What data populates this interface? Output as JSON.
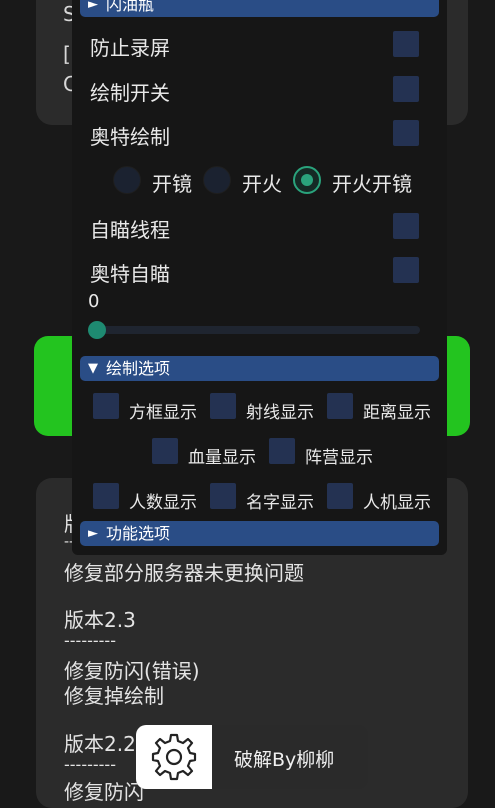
{
  "background": {
    "stubs": [
      "S",
      "[",
      "C"
    ],
    "log_lines_top": [
      "版",
      "--",
      "修复部分服务器未更换问题"
    ],
    "changelog": [
      {
        "version": "版本2.3",
        "separator": "---------",
        "items": [
          "修复防闪(错误)",
          "修复掉绘制"
        ]
      },
      {
        "version": "版本2.2",
        "separator": "---------",
        "items": [
          "修复防闪"
        ]
      }
    ]
  },
  "menu": {
    "section_top": {
      "label": "闪油瓶",
      "arrow": "►"
    },
    "toggles": [
      {
        "label": "防止录屏",
        "checked": false
      },
      {
        "label": "绘制开关",
        "checked": false
      },
      {
        "label": "奥特绘制",
        "checked": false
      }
    ],
    "radios": [
      {
        "label": "开镜",
        "selected": false
      },
      {
        "label": "开火",
        "selected": false
      },
      {
        "label": "开火开镜",
        "selected": true
      }
    ],
    "toggles2": [
      {
        "label": "自瞄线程",
        "checked": false
      },
      {
        "label": "奥特自瞄",
        "checked": false
      }
    ],
    "slider": {
      "value": "0",
      "level": 0
    },
    "draw_section": {
      "label": "绘制选项",
      "arrow": "▼"
    },
    "draw_options": [
      {
        "label": "方框显示",
        "checked": false
      },
      {
        "label": "射线显示",
        "checked": false
      },
      {
        "label": "距离显示",
        "checked": false
      },
      {
        "label": "血量显示",
        "checked": false
      },
      {
        "label": "阵营显示",
        "checked": false
      },
      {
        "label": "人数显示",
        "checked": false
      },
      {
        "label": "名字显示",
        "checked": false
      },
      {
        "label": "人机显示",
        "checked": false
      }
    ],
    "func_section": {
      "label": "功能选项",
      "arrow": "►"
    }
  },
  "toast": {
    "icon": "gear-icon",
    "text": "破解By柳柳"
  },
  "colors": {
    "header": "#2a4d86",
    "checkbox": "#243252",
    "accent": "#2aa37c",
    "green_button": "#23c41f"
  }
}
